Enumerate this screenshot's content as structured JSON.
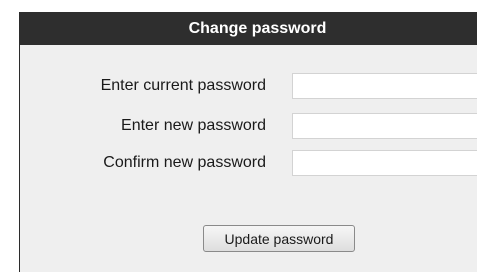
{
  "dialog": {
    "title": "Change password"
  },
  "form": {
    "fields": [
      {
        "label": "Enter current password",
        "value": ""
      },
      {
        "label": "Enter new password",
        "value": ""
      },
      {
        "label": "Confirm new password",
        "value": ""
      }
    ],
    "submit_label": "Update password"
  }
}
